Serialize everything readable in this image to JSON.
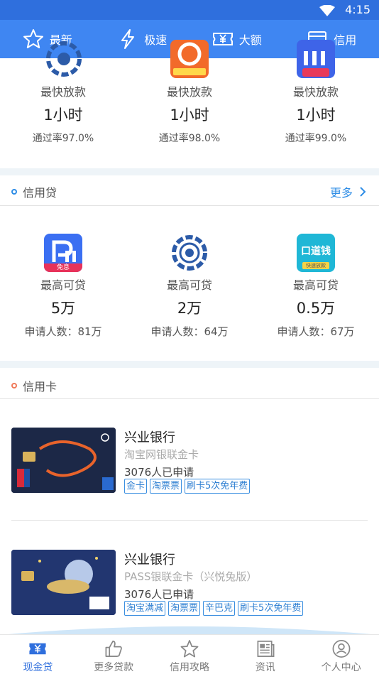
{
  "status": {
    "time": "4:15"
  },
  "topnav": [
    {
      "label": "最新",
      "icon": "star-icon"
    },
    {
      "label": "极速",
      "icon": "lightning-icon"
    },
    {
      "label": "大额",
      "icon": "yen-ticket-icon"
    },
    {
      "label": "信用",
      "icon": "card-icon"
    }
  ],
  "fast_loans": [
    {
      "label": "最快放款",
      "value": "1小时",
      "rate": "通过率97.0%"
    },
    {
      "label": "最快放款",
      "value": "1小时",
      "rate": "通过率98.0%"
    },
    {
      "label": "最快放款",
      "value": "1小时",
      "rate": "通过率99.0%"
    }
  ],
  "credit_loan": {
    "title": "信用贷",
    "more": "更多",
    "items": [
      {
        "label": "最高可贷",
        "value": "5万",
        "applicants": "申请人数：81万",
        "badge": "免息"
      },
      {
        "label": "最高可贷",
        "value": "2万",
        "applicants": "申请人数：64万"
      },
      {
        "label": "最高可贷",
        "value": "0.5万",
        "applicants": "申请人数：67万",
        "logo_text": "口道钱",
        "logo_sub": "快速放款"
      }
    ]
  },
  "credit_card": {
    "title": "信用卡",
    "cards": [
      {
        "bank": "兴业银行",
        "name": "淘宝网银联金卡",
        "applied": "3076人已申请",
        "tags": [
          "金卡",
          "淘票票",
          "刷卡5次免年费"
        ]
      },
      {
        "bank": "兴业银行",
        "name": "PASS银联金卡（兴悦兔版）",
        "applied": "3076人已申请",
        "tags": [
          "淘宝满减",
          "淘票票",
          "辛巴克",
          "刷卡5次免年费"
        ]
      }
    ]
  },
  "bottomnav": [
    {
      "label": "现金贷",
      "icon": "cash-icon",
      "active": true
    },
    {
      "label": "更多贷款",
      "icon": "thumbs-up-icon"
    },
    {
      "label": "信用攻略",
      "icon": "star-outline-icon"
    },
    {
      "label": "资讯",
      "icon": "news-icon"
    },
    {
      "label": "个人中心",
      "icon": "user-icon"
    }
  ],
  "colors": {
    "primary": "#3f86f2",
    "status_bar": "#2f6fdd",
    "link": "#2e8de6",
    "tag": "#2e7fd2"
  }
}
